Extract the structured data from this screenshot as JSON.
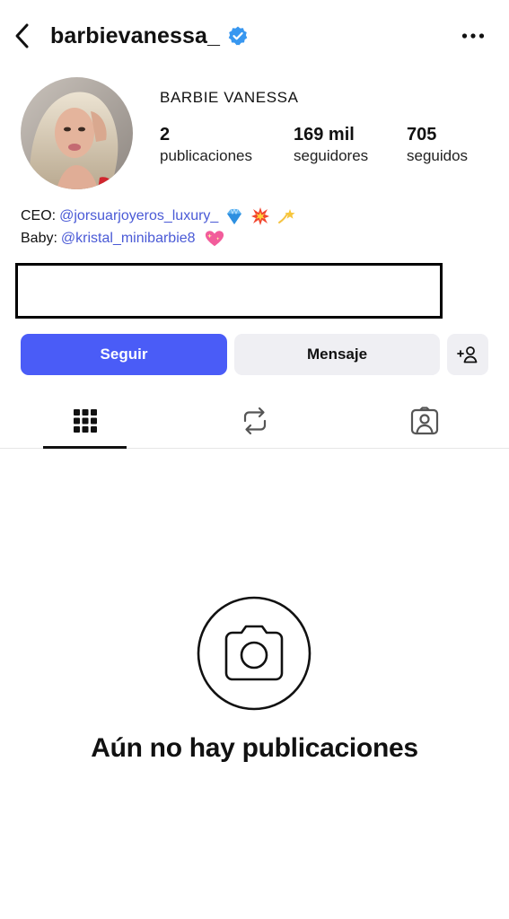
{
  "header": {
    "username": "barbievanessa_",
    "verified": true,
    "icons": {
      "back": "chevron-left-icon",
      "verified": "verified-badge-icon",
      "more": "more-horizontal-icon"
    }
  },
  "profile": {
    "display_name": "BARBIE VANESSA",
    "stats": {
      "posts": {
        "value": "2",
        "label": "publicaciones"
      },
      "followers": {
        "value": "169 mil",
        "label": "seguidores"
      },
      "following": {
        "value": "705",
        "label": "seguidos"
      }
    },
    "bio": {
      "line1_prefix": "CEO:",
      "line1_mention": "@jorsuarjoyeros_luxury_",
      "line1_emojis": [
        "gem-emoji",
        "collision-emoji",
        "dizzy-emoji"
      ],
      "line2_prefix": "Baby:",
      "line2_mention": "@kristal_minibarbie8",
      "line2_emojis": [
        "sparkling-heart-emoji"
      ]
    }
  },
  "actions": {
    "follow_label": "Seguir",
    "message_label": "Mensaje",
    "add_user_icon": "add-user-icon"
  },
  "tabs": [
    {
      "name": "grid",
      "icon": "grid-icon",
      "active": true
    },
    {
      "name": "reposts",
      "icon": "repost-icon",
      "active": false
    },
    {
      "name": "tagged",
      "icon": "tagged-person-icon",
      "active": false
    }
  ],
  "empty_state": {
    "icon": "camera-icon",
    "message": "Aún no hay publicaciones"
  },
  "colors": {
    "primary_button": "#4a5cf7",
    "secondary_button": "#efeff3",
    "mention": "#4a5ad6",
    "verified": "#3897f0"
  }
}
